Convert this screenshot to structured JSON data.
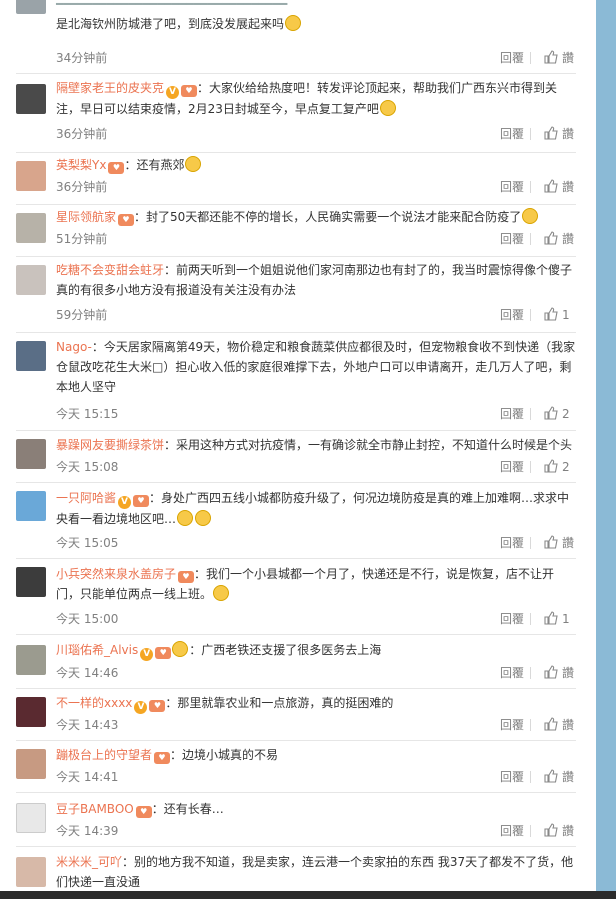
{
  "labels": {
    "reply": "回覆",
    "like_placeholder": "讚"
  },
  "comments": [
    {
      "user": "",
      "badges": [],
      "text": "是北海钦州防城港了吧，到底没发展起来吗",
      "time": "34分钟前",
      "likes": "讚"
    },
    {
      "user": "隔壁家老王的皮夹克",
      "badges": [
        "V"
      ],
      "text": "：大家伙给给热度吧！转发评论顶起来，帮助我们广西东兴市得到关注，早日可以结束疫情，2月23日封城至今，早点复工复产吧",
      "time": "36分钟前",
      "likes": "讚"
    },
    {
      "user": "英梨梨Yx",
      "badges": [],
      "text": "：还有燕郊",
      "time": "36分钟前",
      "likes": "讚"
    },
    {
      "user": "星际领航家",
      "badges": [],
      "text": "：封了50天都还能不停的增长，人民确实需要一个说法才能来配合防疫了",
      "time": "51分钟前",
      "likes": "讚"
    },
    {
      "user": "吃糖不会变甜会蛀牙",
      "badges": [],
      "text": "：前两天听到一个姐姐说他们家河南那边也有封了的，我当时震惊得像个傻子 真的有很多小地方没有报道没有关注没有办法",
      "time": "59分钟前",
      "likes": "1"
    },
    {
      "user": "Nago-",
      "badges": [],
      "text": "：今天居家隔离第49天，物价稳定和粮食蔬菜供应都很及时，但宠物粮食收不到快递（我家仓鼠改吃花生大米□）担心收入低的家庭很难撑下去，外地户口可以申请离开，走几万人了吧，剩本地人坚守",
      "time": "今天 15:15",
      "likes": "2"
    },
    {
      "user": "暴躁网友要撕绿茶饼",
      "badges": [],
      "text": "：采用这种方式对抗疫情，一有确诊就全市静止封控，不知道什么时候是个头",
      "time": "今天 15:08",
      "likes": "2"
    },
    {
      "user": "一只阿哈酱",
      "badges": [
        "V"
      ],
      "text": "：身处广西四五线小城都防疫升级了，何况边境防疫是真的难上加难啊…求求中央看一看边境地区吧…",
      "time": "今天 15:05",
      "likes": "讚"
    },
    {
      "user": "小兵突然来泉水盖房子",
      "badges": [],
      "text": "：我们一个小县城都一个月了，快递还是不行，说是恢复，店不让开门，只能单位两点一线上班。",
      "time": "今天 15:00",
      "likes": "1"
    },
    {
      "user": "川瑙佑希_Alvis",
      "badges": [
        "V"
      ],
      "text": "：广西老铁还支援了很多医务去上海",
      "time": "今天 14:46",
      "likes": "讚"
    },
    {
      "user": "不一样的xxxx",
      "badges": [
        "V"
      ],
      "text": "：那里就靠农业和一点旅游，真的挺困难的",
      "time": "今天 14:43",
      "likes": "讚"
    },
    {
      "user": "蹦极台上的守望者",
      "badges": [],
      "text": "：边境小城真的不易",
      "time": "今天 14:41",
      "likes": "讚"
    },
    {
      "user": "豆子BAMBOO",
      "badges": [],
      "text": "：还有长春…",
      "time": "今天 14:39",
      "likes": "讚"
    },
    {
      "user": "米米米_可吖",
      "badges": [],
      "text": "：别的地方我不知道，我是卖家，连云港一个卖家拍的东西 我37天了都发不了货，他们快递一直没通",
      "time": "",
      "likes": ""
    }
  ],
  "colors": {
    "username": "#eb7350",
    "text": "#333333",
    "muted": "#808080",
    "scrollbar": "#8bbad6"
  }
}
